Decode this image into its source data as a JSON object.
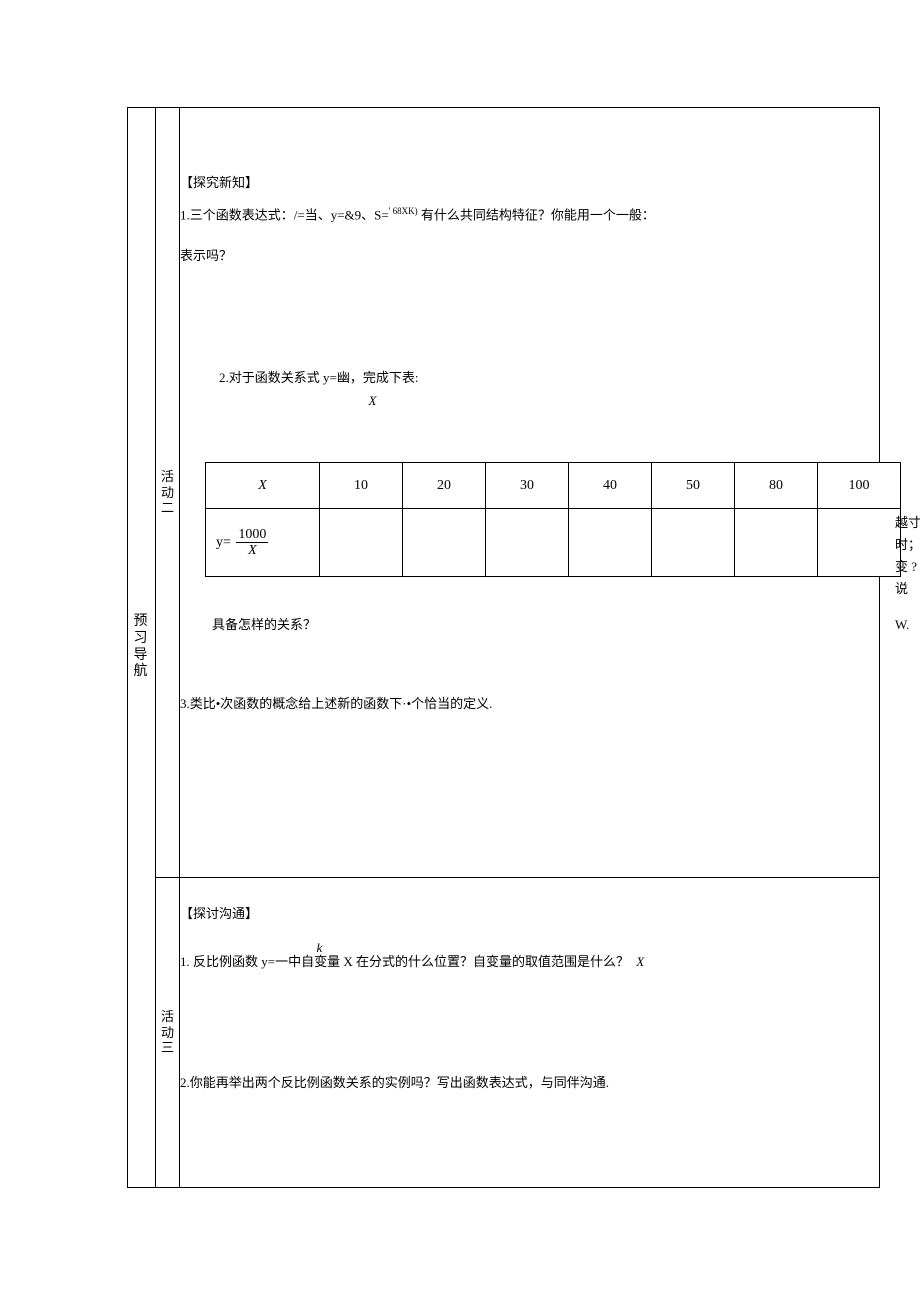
{
  "left_label": "预习导航",
  "activity2_label": "活动二",
  "activity3_label": "活动三",
  "sect2_title": "【探究新知】",
  "q2_1a": "1.三个函数表达式：/=当、y=&9、S=",
  "q2_1sup": "' 68XK)",
  "q2_1b": " 有什么共同结构特征？你能用一个一般：",
  "q2_1c": "表示吗？",
  "q2_2a": "2.对于函数关系式 y=幽，完成下表:",
  "q2_2frac_bot": "X",
  "q2_after": "具备怎样的关系？",
  "q2_3": "3.类比•次函数的概念给上述新的函数下·•个恰当的定义.",
  "sect3_title": "【探讨沟通】",
  "q3_1a": "1. 反比例函数 y=一中自变量 X 在分式的什么位置？自变量的取值范围是什么？",
  "q3_1k": "k",
  "q3_1x": "X",
  "q3_2": "2.你能再举出两个反比例函数关系的实例吗？写出函数表达式，与同伴沟通.",
  "table": {
    "row1": [
      "X",
      "10",
      "20",
      "30",
      "40",
      "50",
      "80",
      "100"
    ],
    "row2_prefix": "y=",
    "row2_num": "1000",
    "row2_den": "X"
  },
  "side": [
    "越寸",
    "时；",
    "变 ?",
    "说"
  ],
  "side_w": "W."
}
